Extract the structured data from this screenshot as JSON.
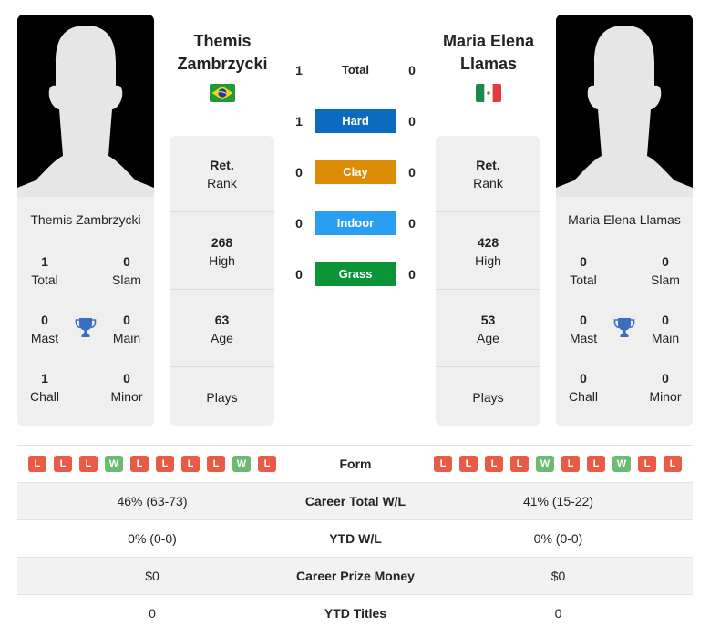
{
  "colors": {
    "hard": "#0b6bc0",
    "clay": "#dd8c06",
    "indoor": "#2a9ef0",
    "grass": "#0b9338",
    "loss": "#ea5b45",
    "win": "#6bbb72",
    "trophy": "#3a6fc0"
  },
  "player1": {
    "name": "Themis Zambrzycki",
    "name_line1": "Themis",
    "name_line2": "Zambrzycki",
    "flag": "brazil-flag",
    "card_name": "Themis Zambrzycki",
    "titles": {
      "total": {
        "value": "1",
        "label": "Total"
      },
      "slam": {
        "value": "0",
        "label": "Slam"
      },
      "mast": {
        "value": "0",
        "label": "Mast"
      },
      "main": {
        "value": "0",
        "label": "Main"
      },
      "chall": {
        "value": "1",
        "label": "Chall"
      },
      "minor": {
        "value": "0",
        "label": "Minor"
      }
    },
    "rank": {
      "value": "Ret.",
      "label": "Rank"
    },
    "high": {
      "value": "268",
      "label": "High"
    },
    "age": {
      "value": "63",
      "label": "Age"
    },
    "plays": {
      "value": "",
      "label": "Plays"
    },
    "form": [
      "L",
      "L",
      "L",
      "W",
      "L",
      "L",
      "L",
      "L",
      "W",
      "L"
    ],
    "career_wl": "46% (63-73)",
    "ytd_wl": "0% (0-0)",
    "prize": "$0",
    "ytd_titles": "0"
  },
  "player2": {
    "name": "Maria Elena Llamas",
    "name_line1": "Maria Elena",
    "name_line2": "Llamas",
    "flag": "mexico-flag",
    "card_name": "Maria Elena Llamas",
    "titles": {
      "total": {
        "value": "0",
        "label": "Total"
      },
      "slam": {
        "value": "0",
        "label": "Slam"
      },
      "mast": {
        "value": "0",
        "label": "Mast"
      },
      "main": {
        "value": "0",
        "label": "Main"
      },
      "chall": {
        "value": "0",
        "label": "Chall"
      },
      "minor": {
        "value": "0",
        "label": "Minor"
      }
    },
    "rank": {
      "value": "Ret.",
      "label": "Rank"
    },
    "high": {
      "value": "428",
      "label": "High"
    },
    "age": {
      "value": "53",
      "label": "Age"
    },
    "plays": {
      "value": "",
      "label": "Plays"
    },
    "form": [
      "L",
      "L",
      "L",
      "L",
      "W",
      "L",
      "L",
      "W",
      "L",
      "L"
    ],
    "career_wl": "41% (15-22)",
    "ytd_wl": "0% (0-0)",
    "prize": "$0",
    "ytd_titles": "0"
  },
  "h2h": {
    "total": {
      "label": "Total",
      "p1": "1",
      "p2": "0"
    },
    "hard": {
      "label": "Hard",
      "p1": "1",
      "p2": "0"
    },
    "clay": {
      "label": "Clay",
      "p1": "0",
      "p2": "0"
    },
    "indoor": {
      "label": "Indoor",
      "p1": "0",
      "p2": "0"
    },
    "grass": {
      "label": "Grass",
      "p1": "0",
      "p2": "0"
    }
  },
  "table_labels": {
    "form": "Form",
    "career_wl": "Career Total W/L",
    "ytd_wl": "YTD W/L",
    "prize": "Career Prize Money",
    "ytd_titles": "YTD Titles"
  }
}
